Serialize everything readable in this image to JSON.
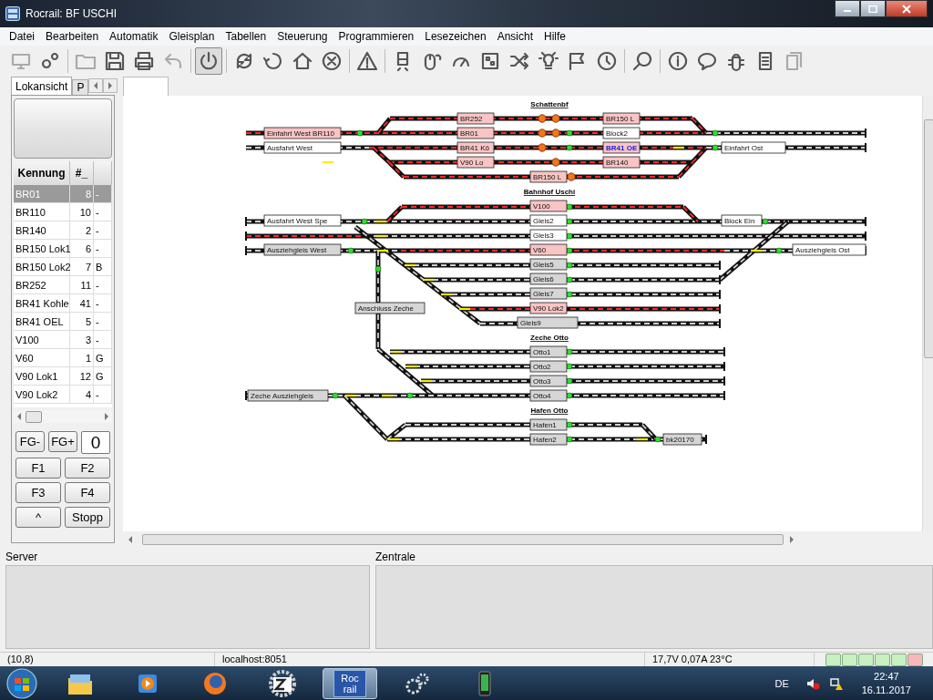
{
  "window": {
    "title": "Rocrail: BF USCHI"
  },
  "menu": [
    "Datei",
    "Bearbeiten",
    "Automatik",
    "Gleisplan",
    "Tabellen",
    "Steuerung",
    "Programmieren",
    "Lesezeichen",
    "Ansicht",
    "Hilfe"
  ],
  "toolbar": {
    "power_pressed": true
  },
  "left_tabs": [
    {
      "label": "Lokansicht",
      "selected": true
    },
    {
      "label": "P",
      "selected": false
    }
  ],
  "loco_table": {
    "columns": [
      "Kennung",
      "#_"
    ],
    "rows": [
      {
        "name": "BR01",
        "address": "8",
        "column_3": "-",
        "selected": true
      },
      {
        "name": "BR110",
        "address": "10",
        "column_3": "-",
        "selected": false
      },
      {
        "name": "BR140",
        "address": "2",
        "column_3": "-",
        "selected": false
      },
      {
        "name": "BR150 Lok1",
        "address": "6",
        "column_3": "-",
        "selected": false
      },
      {
        "name": "BR150 Lok2",
        "address": "7",
        "column_3": "B",
        "selected": false
      },
      {
        "name": "BR252",
        "address": "11",
        "column_3": "-",
        "selected": false
      },
      {
        "name": "BR41 Kohle",
        "address": "41",
        "column_3": "-",
        "selected": false
      },
      {
        "name": "BR41 OEL",
        "address": "5",
        "column_3": "-",
        "selected": false
      },
      {
        "name": "V100",
        "address": "3",
        "column_3": "-",
        "selected": false
      },
      {
        "name": "V60",
        "address": "1",
        "column_3": "G",
        "selected": false
      },
      {
        "name": "V90 Lok1",
        "address": "12",
        "column_3": "G",
        "selected": false
      },
      {
        "name": "V90 Lok2",
        "address": "4",
        "column_3": "-",
        "selected": false
      }
    ]
  },
  "function_buttons": [
    {
      "kind": "button",
      "label": "FG-"
    },
    {
      "kind": "button",
      "label": "FG+"
    },
    {
      "kind": "display",
      "label": "0"
    },
    {
      "kind": "button",
      "label": "F1"
    },
    {
      "kind": "button",
      "label": "F2"
    },
    {
      "kind": "button",
      "label": "F3"
    },
    {
      "kind": "button",
      "label": "F4"
    },
    {
      "kind": "button",
      "label": "^"
    },
    {
      "kind": "button",
      "label": "Stopp"
    }
  ],
  "track_plan": {
    "sections": [
      {
        "title": "Schattenbf",
        "blocks": [
          {
            "label": "BR252",
            "occupied": true,
            "in_service": true,
            "highlighted": false
          },
          {
            "label": "BR150 L",
            "occupied": true,
            "in_service": true,
            "highlighted": false
          },
          {
            "label": "Einfahrt West BR110",
            "occupied": true,
            "in_service": true,
            "highlighted": false
          },
          {
            "label": "BR01",
            "occupied": true,
            "in_service": true,
            "highlighted": false
          },
          {
            "label": "Block2",
            "occupied": false,
            "in_service": true,
            "highlighted": false
          },
          {
            "label": "Ausfahrt West",
            "occupied": false,
            "in_service": true,
            "highlighted": false
          },
          {
            "label": "BR41 Kö",
            "occupied": true,
            "in_service": true,
            "highlighted": false
          },
          {
            "label": "BR41 OE",
            "occupied": true,
            "in_service": true,
            "highlighted": true
          },
          {
            "label": "Einfahrt Ost",
            "occupied": false,
            "in_service": true,
            "highlighted": false
          },
          {
            "label": "V90 Lo",
            "occupied": true,
            "in_service": true,
            "highlighted": false
          },
          {
            "label": "BR140",
            "occupied": true,
            "in_service": true,
            "highlighted": false
          },
          {
            "label": "BR150 L",
            "occupied": true,
            "in_service": true,
            "highlighted": false
          }
        ]
      },
      {
        "title": "Bahnhof Uschi",
        "blocks": [
          {
            "label": "V100",
            "occupied": true,
            "in_service": true,
            "highlighted": false
          },
          {
            "label": "Ausfahrt West Spe",
            "occupied": false,
            "in_service": true,
            "highlighted": false
          },
          {
            "label": "Gleis2",
            "occupied": false,
            "in_service": true,
            "highlighted": false
          },
          {
            "label": "Block Ein",
            "occupied": false,
            "in_service": true,
            "highlighted": false
          },
          {
            "label": "Gleis3",
            "occupied": false,
            "in_service": true,
            "highlighted": false
          },
          {
            "label": "Ausziehgleis West",
            "occupied": false,
            "in_service": false,
            "highlighted": false
          },
          {
            "label": "V60",
            "occupied": true,
            "in_service": true,
            "highlighted": false
          },
          {
            "label": "Ausziehgleis Ost",
            "occupied": false,
            "in_service": true,
            "highlighted": false
          },
          {
            "label": "Gleis5",
            "occupied": false,
            "in_service": false,
            "highlighted": false
          },
          {
            "label": "Gleis6",
            "occupied": false,
            "in_service": false,
            "highlighted": false
          },
          {
            "label": "Gleis7",
            "occupied": false,
            "in_service": false,
            "highlighted": false
          },
          {
            "label": "Anschluss Zeche",
            "occupied": false,
            "in_service": false,
            "highlighted": false
          },
          {
            "label": "V90 Lok2",
            "occupied": true,
            "in_service": true,
            "highlighted": false
          },
          {
            "label": "Gleis9",
            "occupied": false,
            "in_service": false,
            "highlighted": false
          }
        ]
      },
      {
        "title": "Zeche Otto",
        "blocks": [
          {
            "label": "Otto1",
            "occupied": false,
            "in_service": false,
            "highlighted": false
          },
          {
            "label": "Otto2",
            "occupied": false,
            "in_service": false,
            "highlighted": false
          },
          {
            "label": "Otto3",
            "occupied": false,
            "in_service": false,
            "highlighted": false
          },
          {
            "label": "Zeche Ausziehgleis",
            "occupied": false,
            "in_service": false,
            "highlighted": false
          },
          {
            "label": "Otto4",
            "occupied": false,
            "in_service": false,
            "highlighted": false
          }
        ]
      },
      {
        "title": "Hafen Otto",
        "blocks": [
          {
            "label": "Hafen1",
            "occupied": false,
            "in_service": false,
            "highlighted": false
          },
          {
            "label": "Hafen2",
            "occupied": false,
            "in_service": false,
            "highlighted": false
          },
          {
            "label": "bk20170",
            "occupied": false,
            "in_service": false,
            "highlighted": false
          }
        ]
      }
    ]
  },
  "panels": [
    {
      "title": "Server"
    },
    {
      "title": "Zentrale"
    }
  ],
  "status_bar": {
    "fields": [
      "(10,8)",
      "localhost:8051",
      "17,7V 0,07A 23°C"
    ],
    "leds": [
      {
        "color": "#c8f0c0"
      },
      {
        "color": "#c8f0c0"
      },
      {
        "color": "#c8f0c0"
      },
      {
        "color": "#c8f0c0"
      },
      {
        "color": "#c8f0c0"
      },
      {
        "color": "#f8b8b8"
      }
    ]
  },
  "taskbar": {
    "app_label": [
      "Roc",
      "rail"
    ],
    "language": "DE",
    "time": "22:47",
    "date": "16.11.2017"
  }
}
